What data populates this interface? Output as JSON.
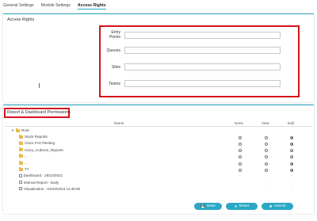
{
  "tabs": [
    {
      "label": "General Settings",
      "active": false
    },
    {
      "label": "Module Settings",
      "active": false
    },
    {
      "label": "Access Rights",
      "active": true
    }
  ],
  "access_rights": {
    "title": "Access Rights",
    "fields": [
      {
        "label": "Entry Points",
        "value": ""
      },
      {
        "label": "Queues",
        "value": ""
      },
      {
        "label": "Sites",
        "value": ""
      },
      {
        "label": "Teams",
        "value": ""
      }
    ]
  },
  "permissions": {
    "title": "Report & Dashboard Permissions",
    "columns": {
      "name": "Name",
      "none": "None",
      "view": "View",
      "edit": "Edit"
    },
    "tree": [
      {
        "label": "Root",
        "type": "folder",
        "level": 0,
        "radios": false
      },
      {
        "label": "Stock Reports",
        "type": "folder",
        "level": 1,
        "radios": true,
        "selected": "edit"
      },
      {
        "label": "Cisco FACTtesting",
        "type": "folder",
        "level": 1,
        "radios": true,
        "selected": "edit"
      },
      {
        "label": "Cisco_Cubone_Reports",
        "type": "folder",
        "level": 1,
        "radios": true,
        "selected": "edit"
      },
      {
        "label": "...",
        "type": "folder",
        "level": 1,
        "radios": true,
        "selected": "edit"
      },
      {
        "label": "...",
        "type": "folder",
        "level": 1,
        "radios": true,
        "selected": "edit"
      },
      {
        "label": "TY",
        "type": "folder",
        "level": 1,
        "radios": true,
        "selected": "edit"
      },
      {
        "label": "Dashboard - 25/10/2021",
        "type": "doc",
        "level": 1,
        "radios": false
      },
      {
        "label": "Interval Report - Daily",
        "type": "doc",
        "level": 1,
        "radios": false
      },
      {
        "label": "Visualization - 04/20/2023 11:40:50",
        "type": "doc",
        "level": 1,
        "radios": false
      }
    ],
    "dash": "-"
  },
  "buttons": {
    "save": {
      "label": "Save",
      "icon": "save-icon"
    },
    "reset": {
      "label": "Reset",
      "icon": "reset-icon"
    },
    "cancel": {
      "label": "Cancel",
      "icon": "close-icon"
    }
  },
  "colors": {
    "accent": "#2aa8c4",
    "highlight": "#d4141c",
    "folder": "#e8b84a"
  }
}
